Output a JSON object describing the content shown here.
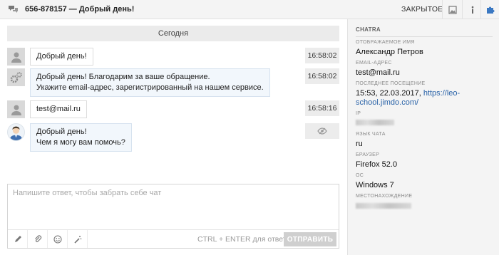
{
  "header": {
    "title": "656-878157 — Добрый день!",
    "status": "ЗАКРЫТОЕ"
  },
  "main": {
    "date_separator": "Сегодня",
    "messages": [
      {
        "text": "Добрый день!",
        "time": "16:58:02",
        "sender": "visitor"
      },
      {
        "text_lines": [
          "Добрый день! Благодарим за ваше обращение.",
          "Укажите email-адрес, зарегистрированный на нашем сервисе."
        ],
        "time": "16:58:02",
        "sender": "bot"
      },
      {
        "text": "test@mail.ru",
        "time": "16:58:16",
        "sender": "visitor"
      },
      {
        "text_lines": [
          "Добрый день!",
          "Чем я могу вам помочь?"
        ],
        "sender": "agent",
        "status_icon": "eye-slash-icon"
      }
    ]
  },
  "composer": {
    "placeholder": "Напишите ответ, чтобы забрать себе чат",
    "hint": "CTRL + ENTER для ответа",
    "send_label": "ОТПРАВИТЬ"
  },
  "sidebar": {
    "title": "CHATRA",
    "fields": {
      "display_name_label": "ОТОБРАЖАЕМОЕ ИМЯ",
      "display_name": "Александр Петров",
      "email_label": "EMAIL-АДРЕС",
      "email": "test@mail.ru",
      "last_visit_label": "ПОСЛЕДНЕЕ ПОСЕЩЕНИЕ",
      "last_visit_time": "15:53, 22.03.2017,",
      "last_visit_url_1": "https://leo-",
      "last_visit_url_2": "school.jimdo.com/",
      "ip_label": "IP",
      "chat_language_label": "ЯЗЫК ЧАТА",
      "chat_language": "ru",
      "browser_label": "БРАУЗЕР",
      "browser": "Firefox 52.0",
      "os_label": "ОС",
      "os": "Windows 7",
      "location_label": "МЕСТОНАХОЖДЕНИЕ"
    }
  },
  "colors": {
    "link": "#2a63a8",
    "agent_bubble": "#f2f7fc",
    "send_disabled": "#cfcfcf"
  }
}
